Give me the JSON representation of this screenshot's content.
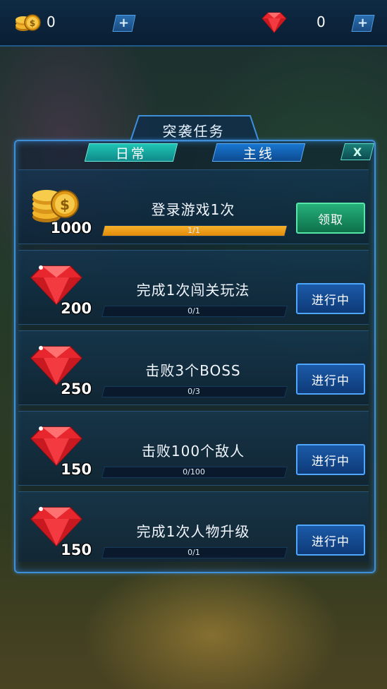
{
  "currency": {
    "coins": "0",
    "gems": "0",
    "plus": "+"
  },
  "panel": {
    "title": "突袭任务",
    "tabs": [
      {
        "label": "日常",
        "active": false
      },
      {
        "label": "主线",
        "active": true
      }
    ],
    "close_label": "X"
  },
  "tasks": [
    {
      "reward_icon": "gold-coins-icon",
      "reward": "1000",
      "name": "登录游戏1次",
      "progress_text": "1/1",
      "progress": 1.0,
      "button": "领取",
      "state": "claim"
    },
    {
      "reward_icon": "red-gem-icon",
      "reward": "200",
      "name": "完成1次闯关玩法",
      "progress_text": "0/1",
      "progress": 0,
      "button": "进行中",
      "state": "in-progress"
    },
    {
      "reward_icon": "red-gem-icon",
      "reward": "250",
      "name": "击败3个BOSS",
      "progress_text": "0/3",
      "progress": 0,
      "button": "进行中",
      "state": "in-progress"
    },
    {
      "reward_icon": "red-gem-icon",
      "reward": "150",
      "name": "击败100个敌人",
      "progress_text": "0/100",
      "progress": 0,
      "button": "进行中",
      "state": "in-progress"
    },
    {
      "reward_icon": "red-gem-icon",
      "reward": "150",
      "name": "完成1次人物升级",
      "progress_text": "0/1",
      "progress": 0,
      "button": "进行中",
      "state": "in-progress"
    }
  ],
  "colors": {
    "accent_blue": "#3e8fd8",
    "claim_green": "#25b07a",
    "progress_orange": "#f6b12a",
    "gem_red": "#e8262e",
    "coin_gold": "#f2b42a"
  }
}
